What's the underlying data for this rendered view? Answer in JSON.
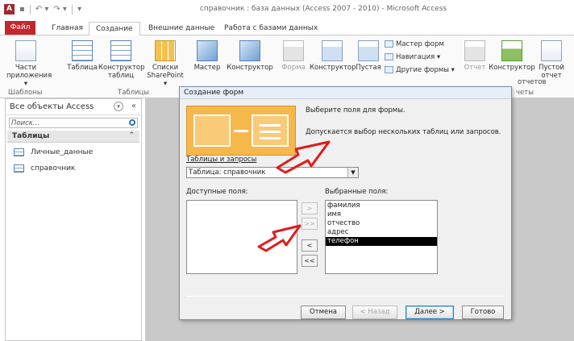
{
  "window": {
    "title": "справочник : база данных (Access 2007 - 2010)  -  Microsoft Access",
    "app_icon": "A"
  },
  "tabs": [
    {
      "label": "Файл"
    },
    {
      "label": "Главная"
    },
    {
      "label": "Создание"
    },
    {
      "label": "Внешние данные"
    },
    {
      "label": "Работа с базами данных"
    }
  ],
  "ribbon": {
    "parts_line1": "Части",
    "parts_line2": "приложения ▾",
    "table": "Таблица",
    "table_design_line1": "Конструктор",
    "table_design_line2": "таблиц",
    "lists_line1": "Списки",
    "lists_line2": "SharePoint ▾",
    "query_wizard": "Мастер",
    "query_design": "Конструктор",
    "form": "Форма",
    "form_design": "Конструктор",
    "blank_form": "Пустая",
    "form_wizard": "Мастер форм",
    "navigation": "Навигация ▾",
    "more_forms": "Другие формы ▾",
    "report": "Отчет",
    "report_design_line1": "Конструктор",
    "report_design_line2": "отчетов",
    "blank_report_line1": "Пустой",
    "blank_report_line2": "отчет",
    "group_templates": "Шаблоны",
    "group_tables": "Таблицы",
    "group_reports": "четы"
  },
  "nav": {
    "header": "Все объекты Access",
    "search_placeholder": "Поиск...",
    "group": "Таблицы",
    "items": [
      {
        "label": "Личные_данные"
      },
      {
        "label": "справочник"
      }
    ]
  },
  "dialog": {
    "title": "Создание форм",
    "instruction1": "Выберите поля для формы.",
    "instruction2": "Допускается выбор нескольких таблиц или запросов.",
    "tables_label": "Таблицы и запросы",
    "tables_value": "Таблица: справочник",
    "available_label": "Доступные поля:",
    "selected_label": "Выбранные поля:",
    "available_fields": [],
    "selected_fields": [
      {
        "label": "фамилия",
        "selected": false
      },
      {
        "label": "имя",
        "selected": false
      },
      {
        "label": "отчество",
        "selected": false
      },
      {
        "label": "адрес",
        "selected": false
      },
      {
        "label": "телефон",
        "selected": true
      }
    ],
    "btn_add": ">",
    "btn_add_all": ">>",
    "btn_remove": "<",
    "btn_remove_all": "<<",
    "btn_cancel": "Отмена",
    "btn_back": "< Назад",
    "btn_next": "Далее >",
    "btn_finish": "Готово"
  },
  "colors": {
    "file_tab": "#c2272d",
    "annotation_arrow": "#e11b1b",
    "wizard_art": "#f7b84b"
  }
}
